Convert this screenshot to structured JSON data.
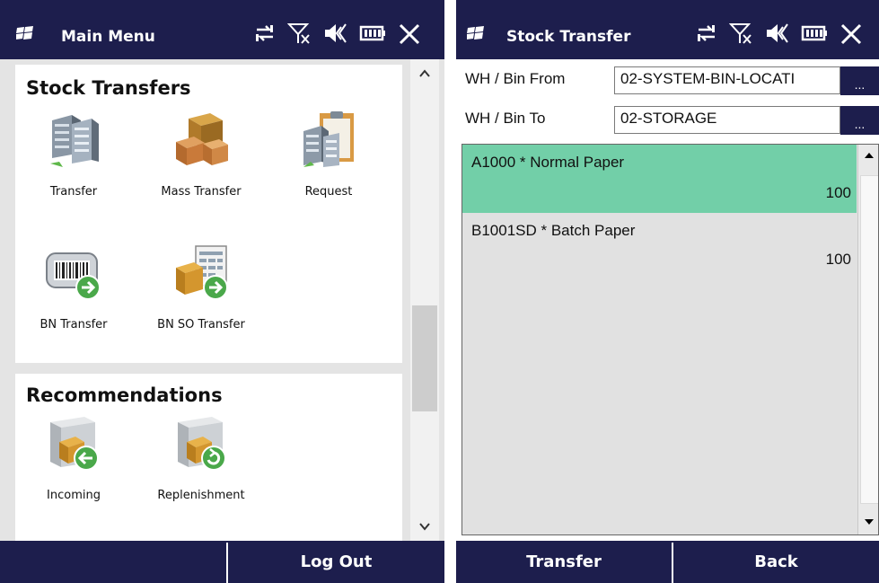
{
  "left_screen": {
    "title": "Main Menu",
    "stock_transfers": {
      "heading": "Stock Transfers",
      "tiles": [
        {
          "label": "Transfer",
          "icon": "servers-transfer-icon"
        },
        {
          "label": "Mass Transfer",
          "icon": "boxes-icon"
        },
        {
          "label": "Request",
          "icon": "clipboard-servers-icon"
        },
        {
          "label": "BN Transfer",
          "icon": "barcode-scanner-icon"
        },
        {
          "label": "BN SO Transfer",
          "icon": "box-document-icon"
        }
      ]
    },
    "recommendations": {
      "heading": "Recommendations",
      "tiles": [
        {
          "label": "Incoming",
          "icon": "incoming-box-icon"
        },
        {
          "label": "Replenishment",
          "icon": "replenish-box-icon"
        }
      ]
    },
    "softkeys": {
      "left": "",
      "right": "Log Out"
    }
  },
  "right_screen": {
    "title": "Stock Transfer",
    "wh_bin_from": {
      "label": "WH / Bin From",
      "value": "02-SYSTEM-BIN-LOCATI"
    },
    "wh_bin_to": {
      "label": "WH / Bin To",
      "value": "02-STORAGE"
    },
    "browse_label": "...",
    "items": [
      {
        "name": "A1000 * Normal Paper",
        "qty": "100",
        "selected": true
      },
      {
        "name": "B1001SD * Batch Paper",
        "qty": "100",
        "selected": false
      }
    ],
    "softkeys": {
      "left": "Transfer",
      "right": "Back"
    }
  },
  "colors": {
    "title_bar": "#1d1e4d",
    "selected_row": "#72cfa8",
    "list_background": "#e1e1e1",
    "panel_background": "#ffffff",
    "desktop_background": "#e4e4e4"
  },
  "tray_icons": [
    "connectivity-icon",
    "no-signal-icon",
    "volume-icon",
    "battery-icon",
    "close-icon"
  ]
}
